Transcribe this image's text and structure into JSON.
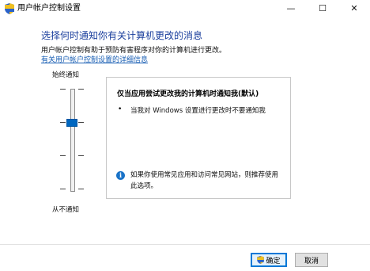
{
  "window": {
    "title": "用户帐户控制设置",
    "minimize": "—",
    "maximize": "☐",
    "close": "✕"
  },
  "main": {
    "heading": "选择何时通知你有关计算机更改的消息",
    "description": "用户帐户控制有助于预防有害程序对你的计算机进行更改。",
    "link": "有关用户帐户控制设置的详细信息"
  },
  "slider": {
    "top_label": "始终通知",
    "bottom_label": "从不通知",
    "level": 2,
    "levels": 4
  },
  "panel": {
    "title": "仅当应用尝试更改我的计算机时通知我(默认)",
    "bullet": "•",
    "bullet_text": "当我对 Windows 设置进行更改时不要通知我",
    "info_icon": "i",
    "info_text": "如果你使用常见应用和访问常见网站，则推荐使用此选项。"
  },
  "buttons": {
    "ok": "确定",
    "cancel": "取消"
  },
  "colors": {
    "heading": "#1b3f9d",
    "link": "#1a5fb4",
    "slider_thumb": "#0067c0",
    "info": "#1a73c8"
  }
}
